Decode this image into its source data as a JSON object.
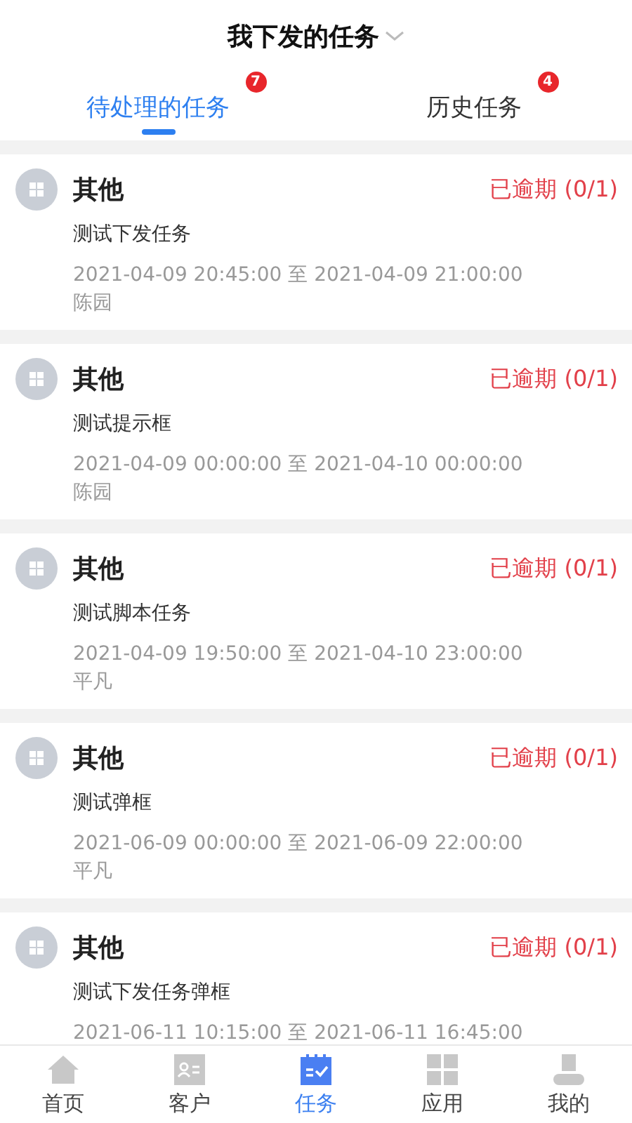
{
  "header": {
    "title": "我下发的任务"
  },
  "tabs": [
    {
      "label": "待处理的任务",
      "badge": "7",
      "selected": true
    },
    {
      "label": "历史任务",
      "badge": "4",
      "selected": false
    }
  ],
  "tasks": [
    {
      "category": "其他",
      "status": "已逾期 (0/1)",
      "name": "测试下发任务",
      "time": "2021-04-09 20:45:00 至 2021-04-09 21:00:00",
      "person": "陈园"
    },
    {
      "category": "其他",
      "status": "已逾期 (0/1)",
      "name": "测试提示框",
      "time": "2021-04-09 00:00:00 至 2021-04-10 00:00:00",
      "person": "陈园"
    },
    {
      "category": "其他",
      "status": "已逾期 (0/1)",
      "name": "测试脚本任务",
      "time": "2021-04-09 19:50:00 至 2021-04-10 23:00:00",
      "person": "平凡"
    },
    {
      "category": "其他",
      "status": "已逾期 (0/1)",
      "name": "测试弹框",
      "time": "2021-06-09 00:00:00 至 2021-06-09 22:00:00",
      "person": "平凡"
    },
    {
      "category": "其他",
      "status": "已逾期 (0/1)",
      "name": "测试下发任务弹框",
      "time": "2021-06-11 10:15:00 至 2021-06-11 16:45:00"
    }
  ],
  "nav": [
    {
      "kind": "home",
      "label": "首页",
      "selected": false
    },
    {
      "kind": "contacts",
      "label": "客户",
      "selected": false
    },
    {
      "kind": "tasks",
      "label": "任务",
      "selected": true
    },
    {
      "kind": "apps",
      "label": "应用",
      "selected": false
    },
    {
      "kind": "me",
      "label": "我的",
      "selected": false
    }
  ]
}
